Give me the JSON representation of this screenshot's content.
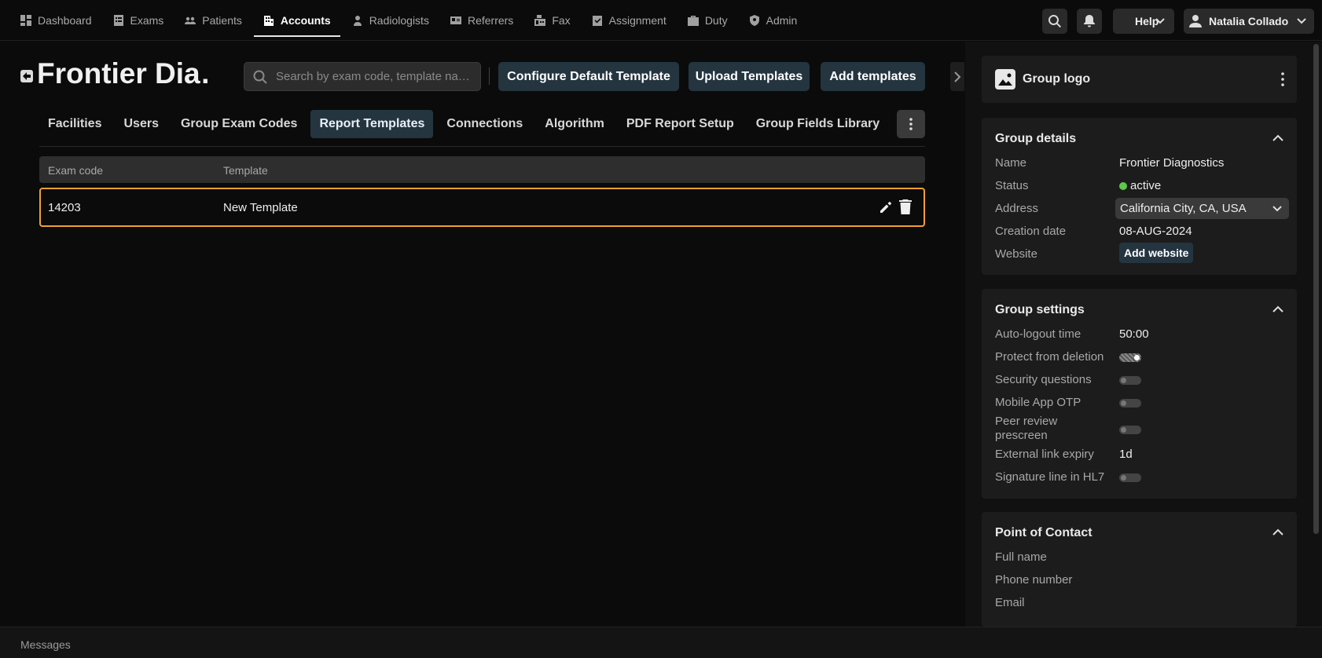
{
  "nav": {
    "items": [
      {
        "label": "Dashboard",
        "icon": "dashboard-icon"
      },
      {
        "label": "Exams",
        "icon": "exams-icon"
      },
      {
        "label": "Patients",
        "icon": "patients-icon"
      },
      {
        "label": "Accounts",
        "icon": "accounts-icon",
        "active": true
      },
      {
        "label": "Radiologists",
        "icon": "radiologist-icon"
      },
      {
        "label": "Referrers",
        "icon": "referrers-icon"
      },
      {
        "label": "Fax",
        "icon": "fax-icon"
      },
      {
        "label": "Assignment",
        "icon": "assignment-icon"
      },
      {
        "label": "Duty",
        "icon": "duty-icon"
      },
      {
        "label": "Admin",
        "icon": "admin-icon"
      }
    ],
    "help_label": "Help",
    "user_name": "Natalia Collado"
  },
  "header": {
    "title": "Frontier Dia…",
    "search_placeholder": "Search by exam code, template na…",
    "configure_label": "Configure Default Template",
    "upload_label": "Upload Templates",
    "add_label": "Add templates"
  },
  "tabs": [
    "Facilities",
    "Users",
    "Group Exam Codes",
    "Report Templates",
    "Connections",
    "Algorithm",
    "PDF Report Setup",
    "Group Fields Library"
  ],
  "active_tab": "Report Templates",
  "table": {
    "columns": [
      "Exam code",
      "Template"
    ],
    "rows": [
      {
        "exam_code": "14203",
        "template": "New Template"
      }
    ]
  },
  "sidebar": {
    "logo_title": "Group logo",
    "details": {
      "title": "Group details",
      "name_label": "Name",
      "name_value": "Frontier Diagnostics",
      "status_label": "Status",
      "status_value": "active",
      "address_label": "Address",
      "address_value": "California City, CA, USA",
      "creation_label": "Creation date",
      "creation_value": "08-AUG-2024",
      "website_label": "Website",
      "website_button": "Add website"
    },
    "settings": {
      "title": "Group settings",
      "autologout_label": "Auto-logout time",
      "autologout_value": "50:00",
      "protect_label": "Protect from deletion",
      "protect_on": true,
      "security_label": "Security questions",
      "mobile_label": "Mobile App OTP",
      "peer_label_1": "Peer review",
      "peer_label_2": "prescreen",
      "extlink_label": "External link expiry",
      "extlink_value": "1d",
      "signature_label": "Signature line in HL7"
    },
    "contact": {
      "title": "Point of Contact",
      "fullname_label": "Full name",
      "phone_label": "Phone number",
      "email_label": "Email"
    }
  },
  "footer": {
    "messages_label": "Messages"
  },
  "colors": {
    "accent": "#243540",
    "highlight": "#f0a030",
    "status_active": "#5cc84a"
  }
}
